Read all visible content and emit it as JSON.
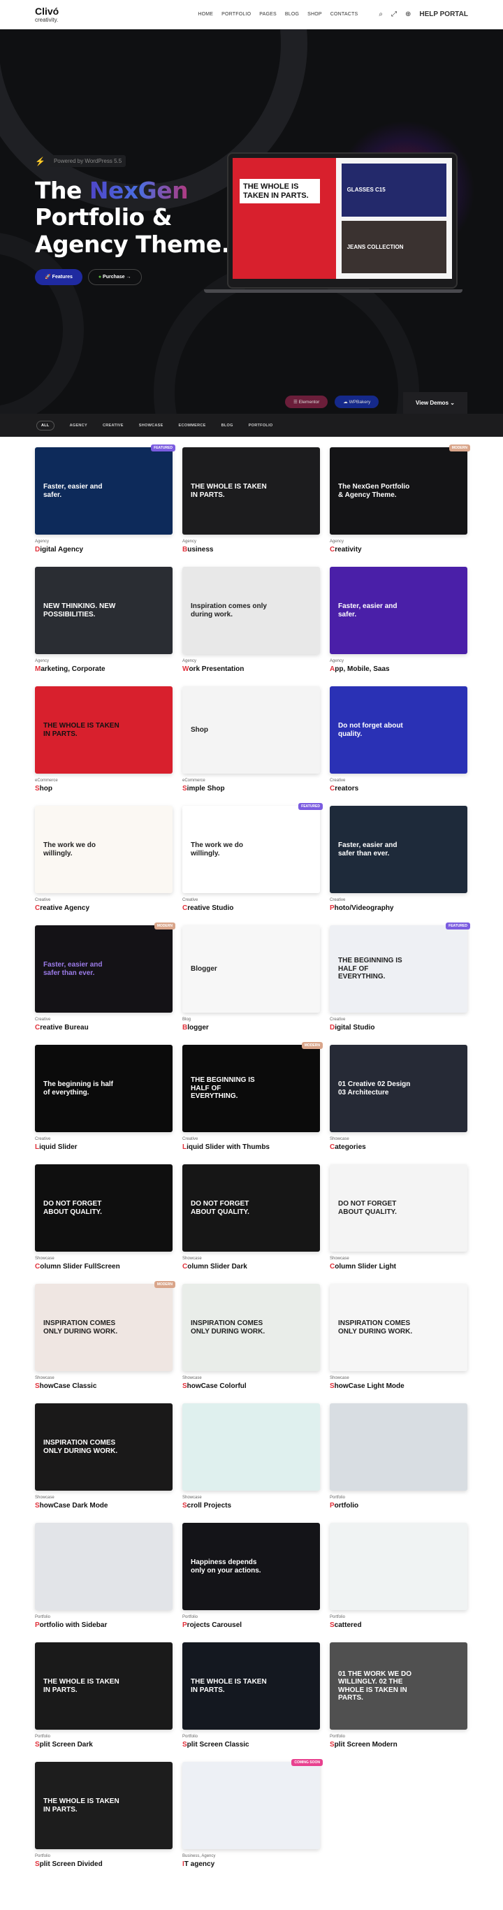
{
  "header": {
    "logo_main": "Clivó",
    "logo_sub": "creativity.",
    "nav": [
      "HOME",
      "PORTFOLIO",
      "PAGES",
      "BLOG",
      "SHOP",
      "CONTACTS"
    ],
    "icons": {
      "search": "⌕",
      "fullscreen": "⤢",
      "globe": "⊕"
    },
    "help_label": "HELP PORTAL"
  },
  "hero": {
    "powered": "Powered by WordPress 5.5",
    "title_1": "The ",
    "title_accent": "NexGen",
    "title_2": "Portfolio &",
    "title_3": "Agency Theme.",
    "btn_features": "Features",
    "btn_purchase": "Purchase →",
    "laptop_headline": "THE WHOLE IS TAKEN IN PARTS.",
    "laptop_card1": "GLASSES C15",
    "laptop_card2": "JEANS COLLECTION",
    "builder_elementor": "Elementor",
    "builder_wpbakery": "WPBakery",
    "view_demos": "View Demos ⌄"
  },
  "filters": [
    "ALL",
    "AGENCY",
    "CREATIVE",
    "SHOWCASE",
    "ECOMMERCE",
    "BLOG",
    "PORTFOLIO"
  ],
  "badge_colors": {
    "FEATURED": "#7b5ce0",
    "MODERN": "#d9a58a",
    "COMING SOON": "#e8418f"
  },
  "accent": "#e0303a",
  "demos": [
    {
      "category": "Agency",
      "title": "Digital Agency",
      "badge": "FEATURED",
      "headline": "Faster, easier and safer.",
      "bg": "#0d2a5a",
      "fg": "#fff"
    },
    {
      "category": "Agency",
      "title": "Business",
      "badge": "",
      "headline": "THE WHOLE IS TAKEN IN PARTS.",
      "bg": "#1c1c1e",
      "fg": "#fff"
    },
    {
      "category": "Agency",
      "title": "Creativity",
      "badge": "MODERN",
      "headline": "The NexGen Portfolio & Agency Theme.",
      "bg": "#141416",
      "fg": "#fff"
    },
    {
      "category": "Agency",
      "title": "Marketing, Corporate",
      "badge": "",
      "headline": "NEW THINKING. NEW POSSIBILITIES.",
      "bg": "#2a2d33",
      "fg": "#fff"
    },
    {
      "category": "Agency",
      "title": "Work Presentation",
      "badge": "",
      "headline": "Inspiration comes only during work.",
      "bg": "#e8e8e8",
      "fg": "#222"
    },
    {
      "category": "Agency",
      "title": "App, Mobile, Saas",
      "badge": "",
      "headline": "Faster, easier and safer.",
      "bg": "#4a1fa8",
      "fg": "#fff"
    },
    {
      "category": "eCommerce",
      "title": "Shop",
      "badge": "",
      "headline": "THE WHOLE IS TAKEN IN PARTS.",
      "bg": "#d8202d",
      "fg": "#111"
    },
    {
      "category": "eCommerce",
      "title": "Simple Shop",
      "badge": "",
      "headline": "Shop",
      "bg": "#f4f4f4",
      "fg": "#222"
    },
    {
      "category": "Creative",
      "title": "Creators",
      "badge": "",
      "headline": "Do not forget about quality.",
      "bg": "#2a31b5",
      "fg": "#fff"
    },
    {
      "category": "Creative",
      "title": "Creative Agency",
      "badge": "",
      "headline": "The work we do willingly.",
      "bg": "#fbf8f3",
      "fg": "#222"
    },
    {
      "category": "Creative",
      "title": "Creative Studio",
      "badge": "FEATURED",
      "headline": "The work we do willingly.",
      "bg": "#ffffff",
      "fg": "#222"
    },
    {
      "category": "Creative",
      "title": "Photo/Videography",
      "badge": "",
      "headline": "Faster, easier and safer than ever.",
      "bg": "#1e2a3a",
      "fg": "#fff"
    },
    {
      "category": "Creative",
      "title": "Creative Bureau",
      "badge": "MODERN",
      "headline": "Faster, easier and safer than ever.",
      "bg": "#141216",
      "fg": "#9b7be8"
    },
    {
      "category": "Blog",
      "title": "Blogger",
      "badge": "",
      "headline": "Blogger",
      "bg": "#f7f7f7",
      "fg": "#222"
    },
    {
      "category": "Creative",
      "title": "Digital Studio",
      "badge": "FEATURED",
      "headline": "THE BEGINNING IS HALF OF EVERYTHING.",
      "bg": "#eef0f4",
      "fg": "#222"
    },
    {
      "category": "Creative",
      "title": "Liquid Slider",
      "badge": "",
      "headline": "The beginning is half of everything.",
      "bg": "#0b0b0b",
      "fg": "#fff"
    },
    {
      "category": "Creative",
      "title": "Liquid Slider with Thumbs",
      "badge": "MODERN",
      "headline": "THE BEGINNING IS HALF OF EVERYTHING.",
      "bg": "#0b0b0b",
      "fg": "#fff"
    },
    {
      "category": "Showcase",
      "title": "Categories",
      "badge": "",
      "headline": "01 Creative 02 Design 03 Architecture",
      "bg": "#262a36",
      "fg": "#fff"
    },
    {
      "category": "Showcase",
      "title": "Column Slider FullScreen",
      "badge": "",
      "headline": "DO NOT FORGET ABOUT QUALITY.",
      "bg": "#0f0f0f",
      "fg": "#fff"
    },
    {
      "category": "Showcase",
      "title": "Column Slider Dark",
      "badge": "",
      "headline": "DO NOT FORGET ABOUT QUALITY.",
      "bg": "#161616",
      "fg": "#fff"
    },
    {
      "category": "Showcase",
      "title": "Column Slider Light",
      "badge": "",
      "headline": "DO NOT FORGET ABOUT QUALITY.",
      "bg": "#f4f4f4",
      "fg": "#222"
    },
    {
      "category": "Showcase",
      "title": "ShowCase Classic",
      "badge": "MODERN",
      "headline": "INSPIRATION COMES ONLY DURING WORK.",
      "bg": "#efe6e2",
      "fg": "#222"
    },
    {
      "category": "Showcase",
      "title": "ShowCase Colorful",
      "badge": "",
      "headline": "INSPIRATION COMES ONLY DURING WORK.",
      "bg": "#e9ede9",
      "fg": "#222"
    },
    {
      "category": "Showcase",
      "title": "ShowCase Light Mode",
      "badge": "",
      "headline": "INSPIRATION COMES ONLY DURING WORK.",
      "bg": "#f6f6f6",
      "fg": "#222"
    },
    {
      "category": "Showcase",
      "title": "ShowCase Dark Mode",
      "badge": "",
      "headline": "INSPIRATION COMES ONLY DURING WORK.",
      "bg": "#1a1919",
      "fg": "#fff"
    },
    {
      "category": "Showcase",
      "title": "Scroll Projects",
      "badge": "",
      "headline": "",
      "bg": "#dff0ee",
      "fg": "#222"
    },
    {
      "category": "Portfolio",
      "title": "Portfolio",
      "badge": "",
      "headline": "",
      "bg": "#d8dde2",
      "fg": "#222"
    },
    {
      "category": "Portfolio",
      "title": "Portfolio with Sidebar",
      "badge": "",
      "headline": "",
      "bg": "#e2e4e8",
      "fg": "#222"
    },
    {
      "category": "Portfolio",
      "title": "Projects Carousel",
      "badge": "",
      "headline": "Happiness depends only on your actions.",
      "bg": "#141418",
      "fg": "#fff"
    },
    {
      "category": "Portfolio",
      "title": "Scattered",
      "badge": "",
      "headline": "",
      "bg": "#f0f3f3",
      "fg": "#222"
    },
    {
      "category": "Portfolio",
      "title": "Split Screen Dark",
      "badge": "",
      "headline": "THE WHOLE IS TAKEN IN PARTS.",
      "bg": "#1a1a1a",
      "fg": "#fff"
    },
    {
      "category": "Portfolio",
      "title": "Split Screen Classic",
      "badge": "",
      "headline": "THE WHOLE IS TAKEN IN PARTS.",
      "bg": "#141820",
      "fg": "#fff"
    },
    {
      "category": "Portfolio",
      "title": "Split Screen Modern",
      "badge": "",
      "headline": "01 THE WORK WE DO WILLINGLY. 02 THE WHOLE IS TAKEN IN PARTS.",
      "bg": "#505050",
      "fg": "#fff"
    },
    {
      "category": "Portfolio",
      "title": "Split Screen Divided",
      "badge": "",
      "headline": "THE WHOLE IS TAKEN IN PARTS.",
      "bg": "#1d1d1d",
      "fg": "#fff"
    },
    {
      "category": "Business, Agency",
      "title": "IT agency",
      "badge": "COMING SOON",
      "headline": "",
      "bg": "#edf0f5",
      "fg": "#222"
    }
  ]
}
